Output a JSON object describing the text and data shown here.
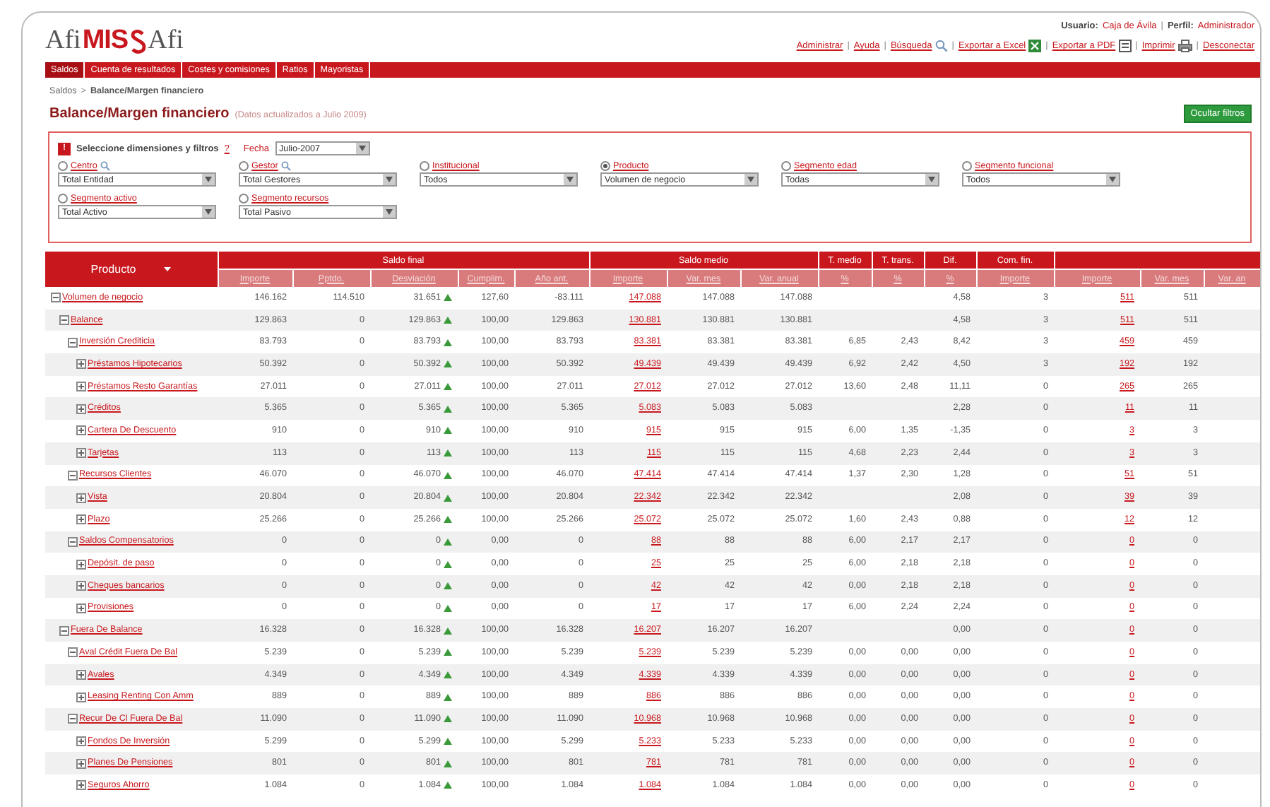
{
  "header": {
    "logo_left": "Afi",
    "logo_mid": "MIS",
    "logo_right": "Afi",
    "separator": "|",
    "user_label": "Usuario:",
    "user": "Caja de Ávila",
    "profile_label": "Perfil:",
    "profile": "Administrador",
    "links": [
      {
        "label": "Administrar",
        "kind": "plain"
      },
      {
        "label": "Ayuda",
        "kind": "plain"
      },
      {
        "label": "Búsqueda",
        "kind": "search"
      },
      {
        "label": "Exportar a Excel",
        "kind": "excel"
      },
      {
        "label": "Exportar a PDF",
        "kind": "pdf"
      },
      {
        "label": "Imprimir",
        "kind": "print"
      },
      {
        "label": "Desconectar",
        "kind": "plain"
      }
    ]
  },
  "nav": [
    {
      "label": "Saldos",
      "selected": true
    },
    {
      "label": "Cuenta de resultados",
      "selected": false
    },
    {
      "label": "Costes y comisiones",
      "selected": false
    },
    {
      "label": "Ratios",
      "selected": false
    },
    {
      "label": "Mayoristas",
      "selected": false
    }
  ],
  "breadcrumb": {
    "separator": ">",
    "items": [
      {
        "label": "Saldos",
        "link": true
      },
      {
        "label": "Balance/Margen financiero",
        "link": false
      }
    ]
  },
  "page": {
    "title": "Balance/Margen financiero",
    "subtitle": "(Datos actualizados a Julio 2009)",
    "button": "Ocultar filtros"
  },
  "filters": {
    "badge": "!",
    "title": "Seleccione dimensiones y filtros",
    "help": "?",
    "date_label": "Fecha",
    "date": "Julio-2007",
    "items": [
      {
        "label": "Centro",
        "value": "Total Entidad",
        "selected": false,
        "search": true
      },
      {
        "label": "Gestor",
        "value": "Total Gestores",
        "selected": false,
        "search": true
      },
      {
        "label": "Institucional",
        "value": "Todos",
        "selected": false,
        "search": false
      },
      {
        "label": "Producto",
        "value": "Volumen de negocio",
        "selected": true,
        "search": false
      },
      {
        "label": "Segmento edad",
        "value": "Todas",
        "selected": false,
        "search": false
      },
      {
        "label": "Segmento funcional",
        "value": "Todos",
        "selected": false,
        "search": false
      },
      {
        "label": "Segmento activo",
        "value": "Total Activo",
        "selected": false,
        "search": false
      },
      {
        "label": "Segmento recursos",
        "value": "Total Pasivo",
        "selected": false,
        "search": false
      }
    ]
  },
  "table": {
    "first_column": "Producto",
    "groups": [
      {
        "label": "Saldo final",
        "columns": [
          {
            "label": "Importe",
            "kind": "number"
          },
          {
            "label": "Pptdo.",
            "kind": "number"
          },
          {
            "label": "Desviación",
            "kind": "deviation"
          },
          {
            "label": "Cumplim.",
            "kind": "number"
          },
          {
            "label": "Año ant.",
            "kind": "number"
          }
        ]
      },
      {
        "label": "Saldo medio",
        "columns": [
          {
            "label": "Importe",
            "kind": "link"
          },
          {
            "label": "Var. mes",
            "kind": "number"
          },
          {
            "label": "Var. anual",
            "kind": "number"
          }
        ]
      },
      {
        "label": "T. medio",
        "columns": [
          {
            "label": "%",
            "kind": "number"
          }
        ]
      },
      {
        "label": "T. trans.",
        "columns": [
          {
            "label": "%",
            "kind": "number"
          }
        ]
      },
      {
        "label": "Dif.",
        "columns": [
          {
            "label": "%",
            "kind": "number"
          }
        ]
      },
      {
        "label": "Com. fin.",
        "columns": [
          {
            "label": "Importe",
            "kind": "number"
          }
        ]
      },
      {
        "columns": [
          {
            "label": "Importe",
            "kind": "link"
          },
          {
            "label": "Var. mes",
            "kind": "number"
          },
          {
            "label": "Var. an"
          }
        ]
      }
    ],
    "rows": [
      {
        "label": "Volumen de negocio",
        "expanded": true,
        "saldo_final": [
          "146.162",
          "114.510",
          "31.651",
          "127,60",
          "-83.111"
        ],
        "saldo_medio": [
          "147.088",
          "147.088",
          "147.088"
        ],
        "dif": "4,58",
        "com_fin": "3",
        "group_7": [
          "511",
          "511"
        ],
        "children": [
          {
            "label": "Balance",
            "expanded": true,
            "saldo_final": [
              "129.863",
              "0",
              "129.863",
              "100,00",
              "129.863"
            ],
            "saldo_medio": [
              "130.881",
              "130.881",
              "130.881"
            ],
            "dif": "4,58",
            "com_fin": "3",
            "group_7": [
              "511",
              "511"
            ],
            "children": [
              {
                "label": "Inversión Crediticia",
                "expanded": true,
                "saldo_final": [
                  "83.793",
                  "0",
                  "83.793",
                  "100,00",
                  "83.793"
                ],
                "saldo_medio": [
                  "83.381",
                  "83.381",
                  "83.381"
                ],
                "t_medio": "6,85",
                "t_trans": "2,43",
                "dif": "8,42",
                "com_fin": "3",
                "group_7": [
                  "459",
                  "459"
                ],
                "children": [
                  {
                    "label": "Préstamos Hipotecarios",
                    "expanded": false,
                    "saldo_final": [
                      "50.392",
                      "0",
                      "50.392",
                      "100,00",
                      "50.392"
                    ],
                    "saldo_medio": [
                      "49.439",
                      "49.439",
                      "49.439"
                    ],
                    "t_medio": "6,92",
                    "t_trans": "2,42",
                    "dif": "4,50",
                    "com_fin": "3",
                    "group_7": [
                      "192",
                      "192"
                    ]
                  },
                  {
                    "label": "Préstamos Resto Garantías",
                    "expanded": false,
                    "saldo_final": [
                      "27.011",
                      "0",
                      "27.011",
                      "100,00",
                      "27.011"
                    ],
                    "saldo_medio": [
                      "27.012",
                      "27.012",
                      "27.012"
                    ],
                    "t_medio": "13,60",
                    "t_trans": "2,48",
                    "dif": "11,11",
                    "com_fin": "0",
                    "group_7": [
                      "265",
                      "265"
                    ]
                  },
                  {
                    "label": "Créditos",
                    "expanded": false,
                    "saldo_final": [
                      "5.365",
                      "0",
                      "5.365",
                      "100,00",
                      "5.365"
                    ],
                    "saldo_medio": [
                      "5.083",
                      "5.083",
                      "5.083"
                    ],
                    "dif": "2,28",
                    "com_fin": "0",
                    "group_7": [
                      "11",
                      "11"
                    ]
                  },
                  {
                    "label": "Cartera De Descuento",
                    "expanded": false,
                    "saldo_final": [
                      "910",
                      "0",
                      "910",
                      "100,00",
                      "910"
                    ],
                    "saldo_medio": [
                      "915",
                      "915",
                      "915"
                    ],
                    "t_medio": "6,00",
                    "t_trans": "1,35",
                    "dif": "-1,35",
                    "com_fin": "0",
                    "group_7": [
                      "3",
                      "3"
                    ]
                  },
                  {
                    "label": "Tarjetas",
                    "expanded": false,
                    "saldo_final": [
                      "113",
                      "0",
                      "113",
                      "100,00",
                      "113"
                    ],
                    "saldo_medio": [
                      "115",
                      "115",
                      "115"
                    ],
                    "t_medio": "4,68",
                    "t_trans": "2,23",
                    "dif": "2,44",
                    "com_fin": "0",
                    "group_7": [
                      "3",
                      "3"
                    ]
                  }
                ]
              },
              {
                "label": "Recursos Clientes",
                "expanded": true,
                "saldo_final": [
                  "46.070",
                  "0",
                  "46.070",
                  "100,00",
                  "46.070"
                ],
                "saldo_medio": [
                  "47.414",
                  "47.414",
                  "47.414"
                ],
                "t_medio": "1,37",
                "t_trans": "2,30",
                "dif": "1,28",
                "com_fin": "0",
                "group_7": [
                  "51",
                  "51"
                ],
                "children": [
                  {
                    "label": "Vista",
                    "expanded": false,
                    "saldo_final": [
                      "20.804",
                      "0",
                      "20.804",
                      "100,00",
                      "20.804"
                    ],
                    "saldo_medio": [
                      "22.342",
                      "22.342",
                      "22.342"
                    ],
                    "dif": "2,08",
                    "com_fin": "0",
                    "group_7": [
                      "39",
                      "39"
                    ]
                  },
                  {
                    "label": "Plazo",
                    "expanded": false,
                    "saldo_final": [
                      "25.266",
                      "0",
                      "25.266",
                      "100,00",
                      "25.266"
                    ],
                    "saldo_medio": [
                      "25.072",
                      "25.072",
                      "25.072"
                    ],
                    "t_medio": "1,60",
                    "t_trans": "2,43",
                    "dif": "0,88",
                    "com_fin": "0",
                    "group_7": [
                      "12",
                      "12"
                    ]
                  }
                ]
              },
              {
                "label": "Saldos Compensatorios",
                "expanded": true,
                "saldo_final": [
                  "0",
                  "0",
                  "0",
                  "0,00",
                  "0"
                ],
                "saldo_medio": [
                  "88",
                  "88",
                  "88"
                ],
                "t_medio": "6,00",
                "t_trans": "2,17",
                "dif": "2,17",
                "com_fin": "0",
                "group_7": [
                  "0",
                  "0"
                ],
                "children": [
                  {
                    "label": "Depósit. de paso",
                    "expanded": false,
                    "saldo_final": [
                      "0",
                      "0",
                      "0",
                      "0,00",
                      "0"
                    ],
                    "saldo_medio": [
                      "25",
                      "25",
                      "25"
                    ],
                    "t_medio": "6,00",
                    "t_trans": "2,18",
                    "dif": "2,18",
                    "com_fin": "0",
                    "group_7": [
                      "0",
                      "0"
                    ]
                  },
                  {
                    "label": "Cheques bancarios",
                    "expanded": false,
                    "saldo_final": [
                      "0",
                      "0",
                      "0",
                      "0,00",
                      "0"
                    ],
                    "saldo_medio": [
                      "42",
                      "42",
                      "42"
                    ],
                    "t_medio": "0,00",
                    "t_trans": "2,18",
                    "dif": "2,18",
                    "com_fin": "0",
                    "group_7": [
                      "0",
                      "0"
                    ]
                  },
                  {
                    "label": "Provisiones",
                    "expanded": false,
                    "saldo_final": [
                      "0",
                      "0",
                      "0",
                      "0,00",
                      "0"
                    ],
                    "saldo_medio": [
                      "17",
                      "17",
                      "17"
                    ],
                    "t_medio": "6,00",
                    "t_trans": "2,24",
                    "dif": "2,24",
                    "com_fin": "0",
                    "group_7": [
                      "0",
                      "0"
                    ]
                  }
                ]
              }
            ]
          },
          {
            "label": "Fuera De Balance",
            "expanded": true,
            "saldo_final": [
              "16.328",
              "0",
              "16.328",
              "100,00",
              "16.328"
            ],
            "saldo_medio": [
              "16.207",
              "16.207",
              "16.207"
            ],
            "dif": "0,00",
            "com_fin": "0",
            "group_7": [
              "0",
              "0"
            ],
            "children": [
              {
                "label": "Aval Crédit Fuera De Bal",
                "expanded": true,
                "saldo_final": [
                  "5.239",
                  "0",
                  "5.239",
                  "100,00",
                  "5.239"
                ],
                "saldo_medio": [
                  "5.239",
                  "5.239",
                  "5.239"
                ],
                "t_medio": "0,00",
                "t_trans": "0,00",
                "dif": "0,00",
                "com_fin": "0",
                "group_7": [
                  "0",
                  "0"
                ],
                "children": [
                  {
                    "label": "Avales",
                    "expanded": false,
                    "saldo_final": [
                      "4.349",
                      "0",
                      "4.349",
                      "100,00",
                      "4.349"
                    ],
                    "saldo_medio": [
                      "4.339",
                      "4.339",
                      "4.339"
                    ],
                    "t_medio": "0,00",
                    "t_trans": "0,00",
                    "dif": "0,00",
                    "com_fin": "0",
                    "group_7": [
                      "0",
                      "0"
                    ]
                  },
                  {
                    "label": "Leasing Renting Con Amm",
                    "expanded": false,
                    "saldo_final": [
                      "889",
                      "0",
                      "889",
                      "100,00",
                      "889"
                    ],
                    "saldo_medio": [
                      "886",
                      "886",
                      "886"
                    ],
                    "t_medio": "0,00",
                    "t_trans": "0,00",
                    "dif": "0,00",
                    "com_fin": "0",
                    "group_7": [
                      "0",
                      "0"
                    ]
                  }
                ]
              },
              {
                "label": "Recur De Cl Fuera De Bal",
                "expanded": true,
                "saldo_final": [
                  "11.090",
                  "0",
                  "11.090",
                  "100,00",
                  "11.090"
                ],
                "saldo_medio": [
                  "10.968",
                  "10.968",
                  "10.968"
                ],
                "t_medio": "0,00",
                "t_trans": "0,00",
                "dif": "0,00",
                "com_fin": "0",
                "group_7": [
                  "0",
                  "0"
                ],
                "children": [
                  {
                    "label": "Fondos De Inversión",
                    "expanded": false,
                    "saldo_final": [
                      "5.299",
                      "0",
                      "5.299",
                      "100,00",
                      "5.299"
                    ],
                    "saldo_medio": [
                      "5.233",
                      "5.233",
                      "5.233"
                    ],
                    "t_medio": "0,00",
                    "t_trans": "0,00",
                    "dif": "0,00",
                    "com_fin": "0",
                    "group_7": [
                      "0",
                      "0"
                    ]
                  },
                  {
                    "label": "Planes De Pensiones",
                    "expanded": false,
                    "saldo_final": [
                      "801",
                      "0",
                      "801",
                      "100,00",
                      "801"
                    ],
                    "saldo_medio": [
                      "781",
                      "781",
                      "781"
                    ],
                    "t_medio": "0,00",
                    "t_trans": "0,00",
                    "dif": "0,00",
                    "com_fin": "0",
                    "group_7": [
                      "0",
                      "0"
                    ]
                  },
                  {
                    "label": "Seguros Ahorro",
                    "expanded": false,
                    "saldo_final": [
                      "1.084",
                      "0",
                      "1.084",
                      "100,00",
                      "1.084"
                    ],
                    "saldo_medio": [
                      "1.084",
                      "1.084",
                      "1.084"
                    ],
                    "t_medio": "0,00",
                    "t_trans": "0,00",
                    "dif": "0,00",
                    "com_fin": "0",
                    "group_7": [
                      "0",
                      "0"
                    ]
                  }
                ]
              }
            ]
          }
        ]
      }
    ]
  }
}
